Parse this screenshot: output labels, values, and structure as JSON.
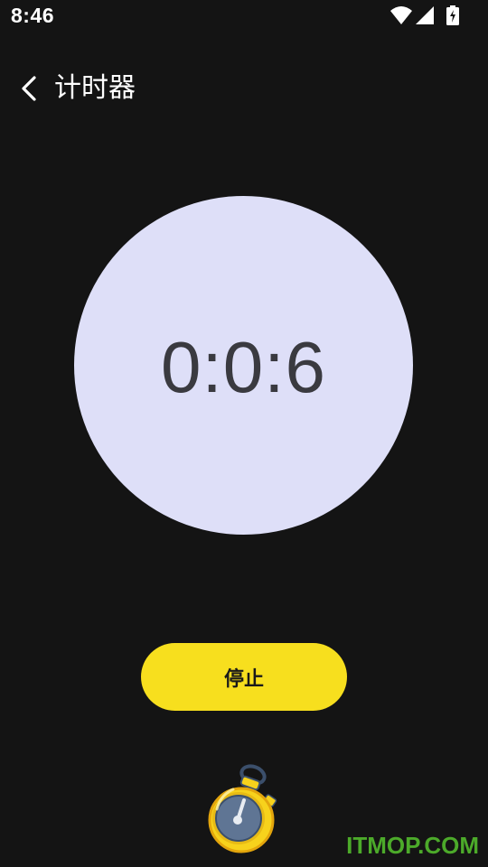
{
  "status_bar": {
    "time": "8:46",
    "icons": [
      "wifi-icon",
      "signal-icon",
      "battery-charging-icon"
    ]
  },
  "header": {
    "back_icon": "chevron-left-icon",
    "title": "计时器"
  },
  "timer": {
    "value": "0:0:6"
  },
  "actions": {
    "stop_label": "停止"
  },
  "illustration": {
    "icon": "stopwatch-icon"
  },
  "watermark": {
    "text": "ITMOP.COM"
  },
  "colors": {
    "background": "#141414",
    "circle": "#dedff8",
    "timer_text": "#3a3a40",
    "stop_button": "#f7df1e",
    "watermark": "#4caa2a"
  }
}
